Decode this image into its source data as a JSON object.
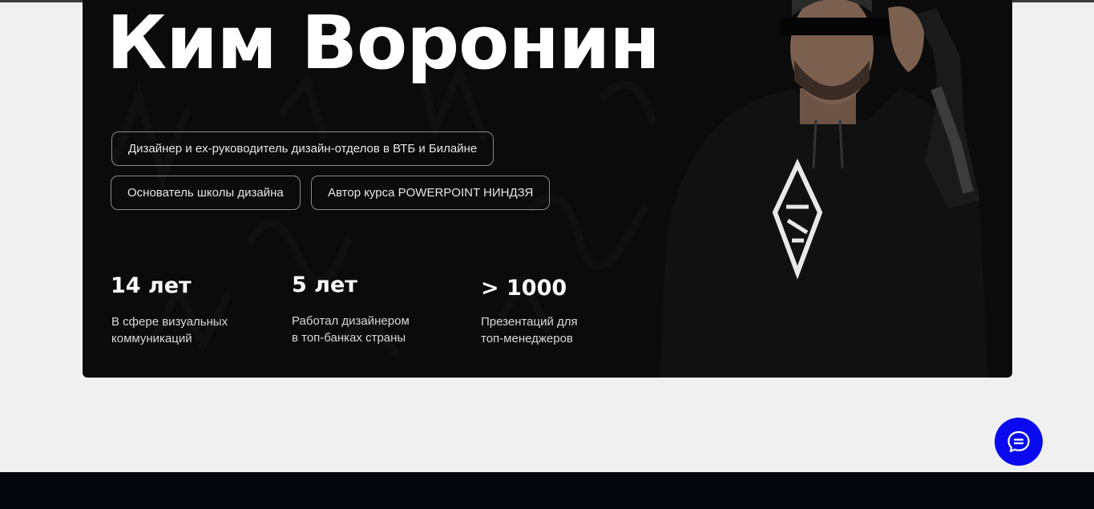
{
  "hero": {
    "name": "Ким Воронин",
    "tags": [
      "Дизайнер и ex-руководитель дизайн-отделов в ВТБ и Билайне",
      "Основатель школы дизайна",
      "Автор курса POWERPOINT НИНДЗЯ"
    ],
    "stats": [
      {
        "value": "14 лет",
        "line1": "В сфере визуальных",
        "line2": "коммуникаций"
      },
      {
        "value": "5 лет",
        "line1": "Работал дизайнером",
        "line2": "в топ-банках страны"
      },
      {
        "value": "> 1000",
        "line1": "Презентаций для",
        "line2": "топ-менеджеров"
      }
    ]
  },
  "colors": {
    "card_background": "#0b0b0b",
    "page_background": "#f0f0f0",
    "chat_button": "#0a0af0",
    "footer": "#05060d"
  },
  "icons": {
    "chat": "chat-bubble-icon"
  }
}
